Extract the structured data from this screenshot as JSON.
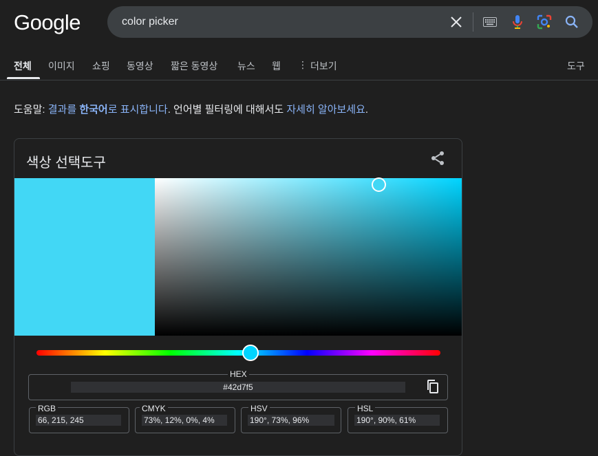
{
  "header": {
    "logo_text": "Google",
    "search_query": "color picker",
    "icons": [
      "clear-icon",
      "keyboard-icon",
      "microphone-icon",
      "lens-icon",
      "search-icon"
    ]
  },
  "tabs": [
    {
      "label": "전체",
      "active": true
    },
    {
      "label": "이미지"
    },
    {
      "label": "쇼핑"
    },
    {
      "label": "동영상"
    },
    {
      "label": "짧은 동영상"
    },
    {
      "label": "뉴스"
    },
    {
      "label": "웹"
    },
    {
      "label": "더보기"
    }
  ],
  "tools_label": "도구",
  "notice": {
    "prefix": "도움말: ",
    "link1_pre": "결과를 ",
    "link1_bold": "한국어",
    "link1_post": "로 표시합니다",
    "sep": ". 언어별 필터링에 대해서도 ",
    "link2": "자세히 알아보세요",
    "end": "."
  },
  "picker": {
    "title": "색상 선택도구",
    "selected_color": "#42d7f5",
    "hue_color": "#00d4ff",
    "hue_fraction": 0.53,
    "sv_saturation": 0.73,
    "sv_value": 0.96,
    "hex": {
      "label": "HEX",
      "value": "#42d7f5"
    },
    "rgb": {
      "label": "RGB",
      "value": "66, 215, 245"
    },
    "cmyk": {
      "label": "CMYK",
      "value": "73%, 12%, 0%, 4%"
    },
    "hsv": {
      "label": "HSV",
      "value": "190°, 73%, 96%"
    },
    "hsl": {
      "label": "HSL",
      "value": "190°, 90%, 61%"
    }
  },
  "colors": {
    "link": "#8ab4f8",
    "background": "#1f1f1f",
    "searchbar": "#3c4043"
  }
}
